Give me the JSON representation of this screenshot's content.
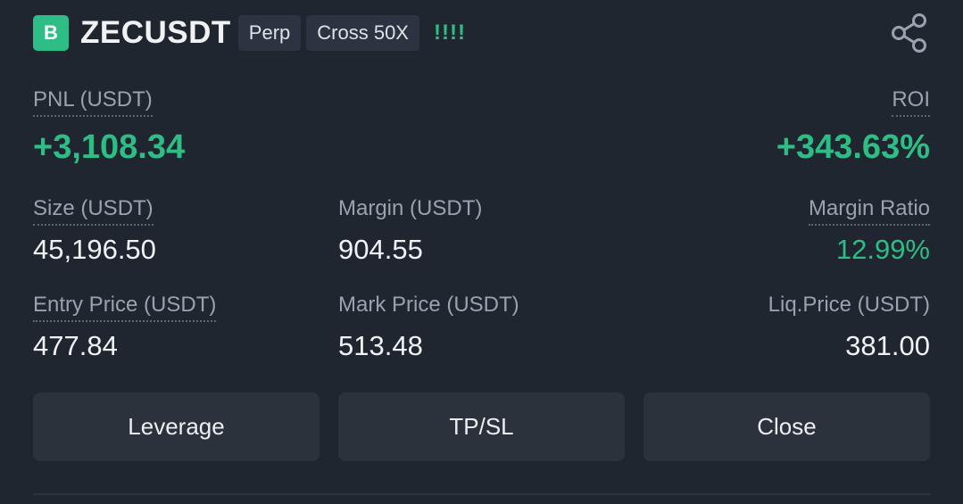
{
  "position": {
    "side_badge": "B",
    "symbol": "ZECUSDT",
    "contract_type": "Perp",
    "margin_mode": "Cross 50X",
    "risk_indicator": "!!!!"
  },
  "pnl": {
    "label": "PNL (USDT)",
    "value": "+3,108.34"
  },
  "roi": {
    "label": "ROI",
    "value": "+343.63%"
  },
  "size": {
    "label": "Size (USDT)",
    "value": "45,196.50"
  },
  "margin": {
    "label": "Margin (USDT)",
    "value": "904.55"
  },
  "margin_ratio": {
    "label": "Margin Ratio",
    "value": "12.99%"
  },
  "entry_price": {
    "label": "Entry Price (USDT)",
    "value": "477.84"
  },
  "mark_price": {
    "label": "Mark Price (USDT)",
    "value": "513.48"
  },
  "liq_price": {
    "label": "Liq.Price (USDT)",
    "value": "381.00"
  },
  "actions": {
    "leverage": "Leverage",
    "tpsl": "TP/SL",
    "close": "Close"
  },
  "icons": {
    "share": "share-icon"
  },
  "colors": {
    "background": "#1f2630",
    "profit_green": "#2ebd85",
    "button_bg": "#2b323c",
    "label_gray": "#9aa3ad"
  }
}
